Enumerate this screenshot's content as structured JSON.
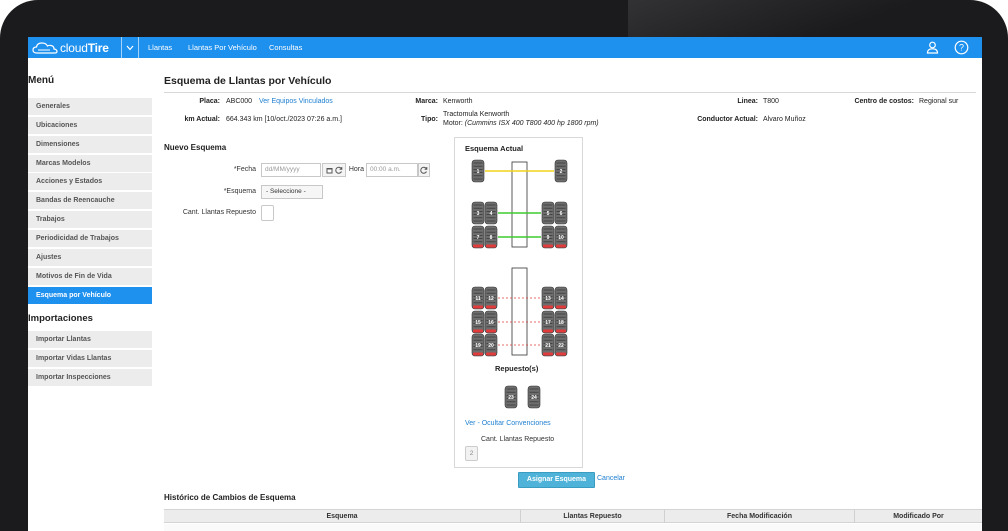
{
  "nav": {
    "logo_prefix": "cloud",
    "logo_suffix": "Tire",
    "items": [
      "Llantas",
      "Llantas Por Vehículo",
      "Consultas"
    ]
  },
  "sidebar": {
    "menu_title": "Menú",
    "items": [
      "Generales",
      "Ubicaciones",
      "Dimensiones",
      "Marcas Modelos",
      "Acciones y Estados",
      "Bandas de Reencauche",
      "Trabajos",
      "Periodicidad de Trabajos",
      "Ajustes",
      "Motivos de Fin de Vida",
      "Esquema por Vehículo"
    ],
    "active_item": "Esquema por Vehículo",
    "imports_title": "Importaciones",
    "import_items": [
      "Importar Llantas",
      "Importar Vidas Llantas",
      "Importar Inspecciones"
    ]
  },
  "page": {
    "title": "Esquema de Llantas por Vehículo"
  },
  "vehicle": {
    "placa_label": "Placa:",
    "placa": "ABC000",
    "linked_link": "Ver Equipos Vinculados",
    "marca_label": "Marca:",
    "marca": "Kenworth",
    "linea_label": "Linea:",
    "linea": "T800",
    "centro_label": "Centro de costos:",
    "centro": "Regional sur",
    "km_label": "km Actual:",
    "km": "664.343 km [10/oct./2023 07:26 a.m.]",
    "tipo_label": "Tipo:",
    "tipo": "Tractomula Kenworth",
    "motor_prefix": "Motor:",
    "motor": "(Cummins ISX 400 T800 400 hp 1800 rpm)",
    "conductor_label": "Conductor Actual:",
    "conductor": "Alvaro Muñoz"
  },
  "form": {
    "section_title": "Nuevo Esquema",
    "fecha_label": "*Fecha",
    "fecha_placeholder": "dd/MM/yyyy",
    "hora_label": "Hora",
    "hora_placeholder": "00:00 a.m.",
    "esquema_label": "*Esquema",
    "esquema_selected": "- Seleccione -",
    "repuesto_label": "Cant. Llantas Repuesto"
  },
  "scheme": {
    "title": "Esquema Actual",
    "spares_title": "Repuesto(s)",
    "toggle_link": "Ver - Ocultar Convenciones",
    "spare_count_label": "Cant. Llantas Repuesto",
    "spare_count": "2",
    "tire_labels": [
      "1",
      "2",
      "3",
      "4",
      "5",
      "6",
      "7",
      "8",
      "9",
      "10",
      "11",
      "12",
      "13",
      "14",
      "15",
      "16",
      "17",
      "18",
      "19",
      "20",
      "21",
      "22",
      "23",
      "24"
    ]
  },
  "actions": {
    "assign": "Asignar Esquema",
    "cancel": "Cancelar"
  },
  "history": {
    "title": "Histórico de Cambios de Esquema",
    "columns": [
      "Esquema",
      "Llantas Repuesto",
      "Fecha Modificación",
      "Modificado Por"
    ]
  },
  "colors": {
    "primary": "#1e90ee",
    "axle_yellow": "#f2d21b",
    "axle_green": "#3dcc2e",
    "tire_red": "#e23b3b"
  }
}
